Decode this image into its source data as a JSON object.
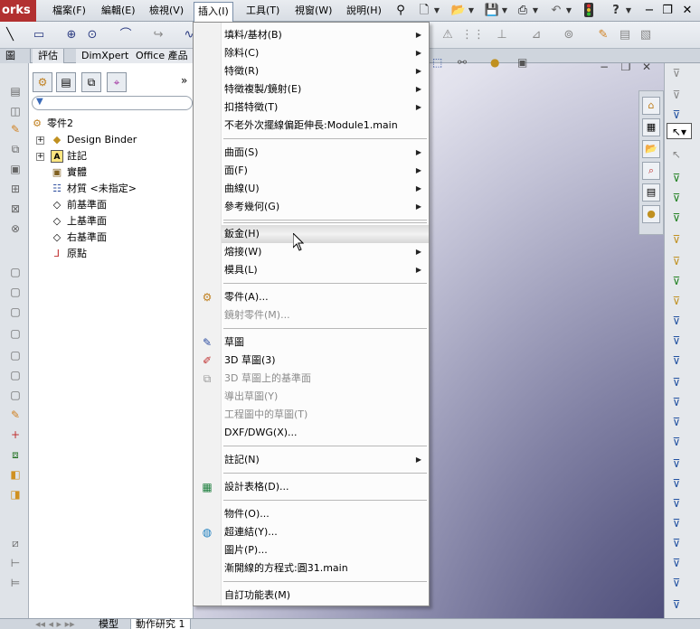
{
  "app": {
    "brand": "orks"
  },
  "menubar": {
    "items": [
      "檔案(F)",
      "編輯(E)",
      "檢視(V)",
      "插入(I)",
      "工具(T)",
      "視窗(W)",
      "說明(H)"
    ],
    "active": "插入(I)"
  },
  "tabs": [
    "評估",
    "DimXpert",
    "Office 產品"
  ],
  "feature_tree": {
    "root": "零件2",
    "items": [
      "Design Binder",
      "註記",
      "實體",
      "材質 <未指定>",
      "前基準面",
      "上基準面",
      "右基準面",
      "原點"
    ]
  },
  "insert_menu": {
    "groups": [
      [
        "填料/基材(B)",
        "除料(C)",
        "特徵(R)",
        "特徵複製/鏡射(E)",
        "扣搭特徵(T)",
        "不老外次擺線偏距伸長:Module1.main"
      ],
      [
        "曲面(S)",
        "面(F)",
        "曲線(U)",
        "參考幾何(G)"
      ],
      [
        "鈑金(H)",
        "熔接(W)",
        "模具(L)"
      ],
      [
        "零件(A)...",
        "鏡射零件(M)..."
      ],
      [
        "草圖",
        "3D 草圖(3)",
        "3D 草圖上的基準面",
        "導出草圖(Y)",
        "工程圖中的草圖(T)",
        "DXF/DWG(X)..."
      ],
      [
        "註記(N)"
      ],
      [
        "設計表格(D)..."
      ],
      [
        "物件(O)...",
        "超連結(Y)...",
        "圖片(P)...",
        "漸開線的方程式:圓31.main"
      ],
      [
        "自訂功能表(M)"
      ]
    ]
  },
  "statusbar": {
    "tabs": [
      "模型",
      "動作研究 1"
    ]
  },
  "colors": {
    "brand": "#b23030",
    "menu_border": "#8a8a8a",
    "disabled_text": "#8c8c8c"
  }
}
